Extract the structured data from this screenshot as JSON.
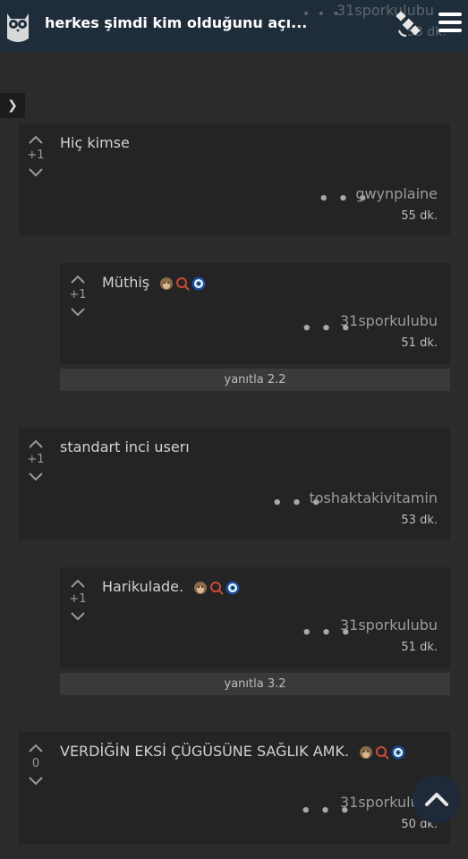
{
  "header": {
    "title": "herkes şimdi kim olduğunu açı...",
    "ghost_user": "31sporkulubu",
    "ghost_time": "53 dk.",
    "ghost_dots": "• • •"
  },
  "comments": [
    {
      "score": "+1",
      "text": "Hiç kimse",
      "dots": "• • •",
      "user": "gwynplaine",
      "time": "55 dk."
    },
    {
      "score": "+1",
      "text": "Müthiş",
      "dots": "• • •",
      "user": "31sporkulubu",
      "time": "51 dk.",
      "reply": "yanıtla 2.2"
    },
    {
      "score": "+1",
      "text": "standart inci userı",
      "dots": "• • •",
      "user": "toshaktakivitamin",
      "time": "53 dk."
    },
    {
      "score": "+1",
      "text": "Harikulade.",
      "dots": "• • •",
      "user": "31sporkulubu",
      "time": "51 dk.",
      "reply": "yanıtla 3.2"
    },
    {
      "score": "0",
      "text": "VERDİĞİN EKSİ ÇÜGÜSÜNE SAĞLIK AMK.",
      "dots": "• • •",
      "user": "31sporkulubu",
      "time": "50 dk."
    }
  ],
  "colors": {
    "header_bg": "#1f2d3a",
    "page_bg": "#2b2b2b",
    "card_bg": "#242424",
    "reply_bar_bg": "#3a3a3a"
  },
  "icons": [
    "owl-logo-icon",
    "satellite-icon",
    "menu-icon",
    "chevron-right-icon",
    "upvote-icon",
    "downvote-icon",
    "monkey-emoji-icon",
    "red-q-icon",
    "nazar-eye-icon",
    "scroll-top-icon"
  ]
}
